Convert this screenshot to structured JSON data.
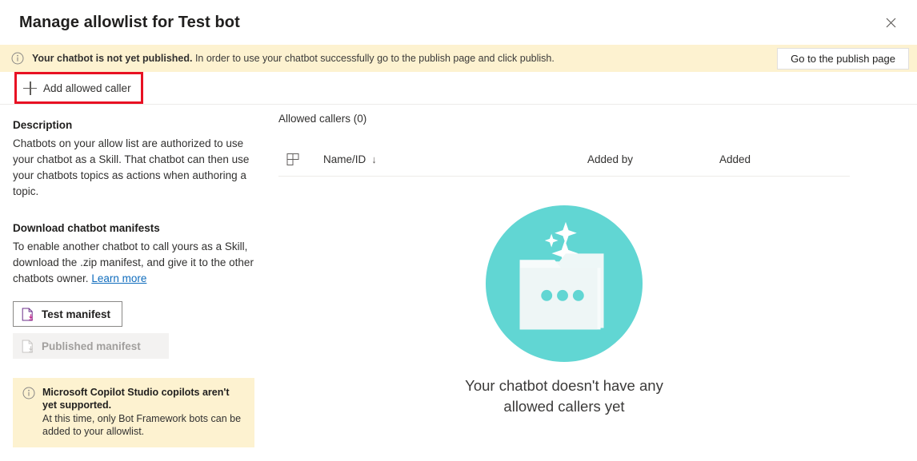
{
  "dialog": {
    "title": "Manage allowlist for Test bot",
    "close_icon": "close-icon"
  },
  "banner": {
    "icon": "info-icon",
    "bold_text": "Your chatbot is not yet published.",
    "rest_text": " In order to use your chatbot successfully go to the publish page and click publish.",
    "action_label": "Go to the publish page"
  },
  "commandbar": {
    "add_caller_label": "Add allowed caller",
    "add_caller_icon": "plus-icon",
    "highlight_color": "#e81123"
  },
  "left_panel": {
    "description_heading": "Description",
    "description_body": "Chatbots on your allow list are authorized to use your chatbot as a Skill. That chatbot can then use your chatbots topics as actions when authoring a topic.",
    "download_heading": "Download chatbot manifests",
    "download_body": "To enable another chatbot to call yours as a Skill, download the .zip manifest, and give it to the other chatbots owner. ",
    "learn_more_label": "Learn more",
    "test_manifest_label": "Test manifest",
    "test_manifest_icon": "document-download-icon",
    "published_manifest_label": "Published manifest",
    "published_manifest_icon": "document-download-icon",
    "warning": {
      "icon": "info-icon",
      "title": "Microsoft Copilot Studio copilots aren't yet supported.",
      "body": "At this time, only Bot Framework bots can be added to your allowlist."
    }
  },
  "main": {
    "list_title": "Allowed callers (0)",
    "table": {
      "select_column_icon": "grid-layout-icon",
      "columns": [
        {
          "label": "Name/ID",
          "sort_indicator": "↓"
        },
        {
          "label": "Added by",
          "sort_indicator": ""
        },
        {
          "label": "Added",
          "sort_indicator": ""
        }
      ],
      "rows": []
    },
    "empty_state": {
      "illustration": "folder-sparkle-illustration",
      "accent_color": "#61d6d3",
      "message": "Your chatbot doesn't have any allowed callers yet"
    }
  }
}
